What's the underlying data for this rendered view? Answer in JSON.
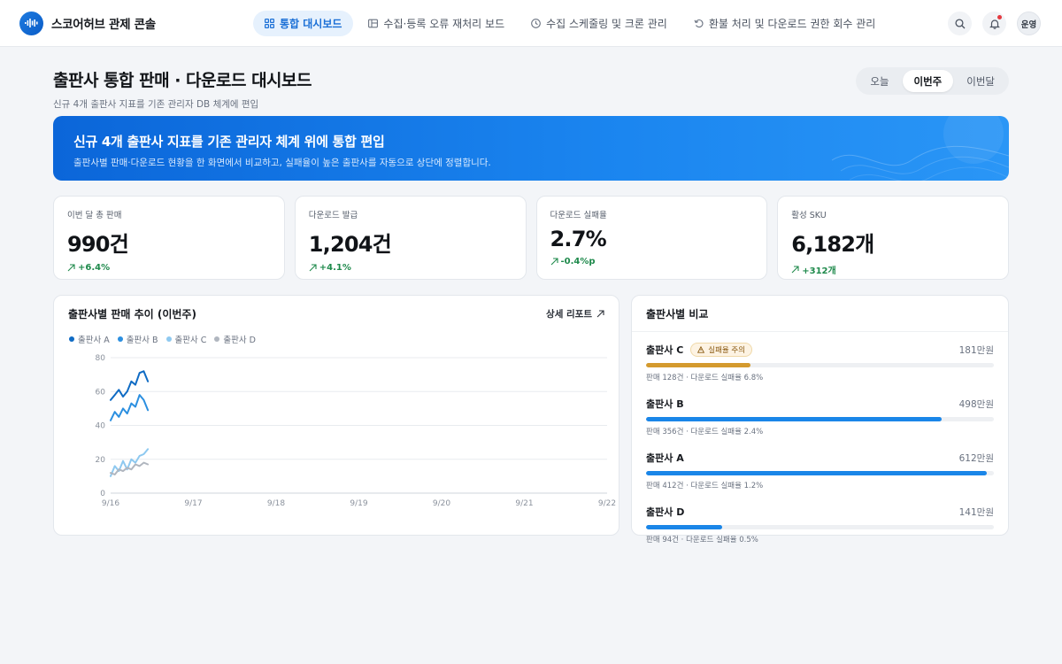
{
  "app": {
    "title": "스코어허브 관제 콘솔"
  },
  "nav": {
    "items": [
      {
        "label": "통합 대시보드",
        "icon": "grid-icon",
        "active": true
      },
      {
        "label": "수집·등록 오류 재처리 보드",
        "icon": "board-icon",
        "active": false
      },
      {
        "label": "수집 스케줄링 및 크론 관리",
        "icon": "clock-icon",
        "active": false
      },
      {
        "label": "환불 처리 및 다운로드 권한 회수 관리",
        "icon": "undo-icon",
        "active": false
      }
    ]
  },
  "user": {
    "avatar_label": "운영"
  },
  "header": {
    "title": "출판사 통합 판매 · 다운로드 대시보드",
    "subtitle": "신규 4개 출판사 지표를 기존 관리자 DB 체계에 편입"
  },
  "period": {
    "options": [
      "오늘",
      "이번주",
      "이번달"
    ],
    "selected": "이번주"
  },
  "banner": {
    "title": "신규 4개 출판사 지표를 기존 관리자 체계 위에 통합 편입",
    "subtitle": "출판사별 판매·다운로드 현황을 한 화면에서 비교하고, 실패율이 높은 출판사를 자동으로 상단에 정렬합니다."
  },
  "kpis": [
    {
      "label": "이번 달 총 판매",
      "value": "990건",
      "delta": "+6.4%"
    },
    {
      "label": "다운로드 발급",
      "value": "1,204건",
      "delta": "+4.1%"
    },
    {
      "label": "다운로드 실패율",
      "value": "2.7%",
      "delta": "-0.4%p"
    },
    {
      "label": "활성 SKU",
      "value": "6,182개",
      "delta": "+312개"
    }
  ],
  "trend_card": {
    "title": "출판사별 판매 추이 (이번주)",
    "link_label": "상세 리포트"
  },
  "chart_data": {
    "type": "line",
    "title": "",
    "xlabel": "",
    "ylabel": "",
    "x": [
      "9/16",
      "9/17",
      "9/18",
      "9/19",
      "9/20",
      "9/21",
      "9/22"
    ],
    "x_index_range": [
      0,
      6
    ],
    "ylim": [
      0,
      80
    ],
    "yticks": [
      0,
      20,
      40,
      60,
      80
    ],
    "grid": true,
    "legend_position": "top-left",
    "series": [
      {
        "name": "출판사 A",
        "color": "#0f6bc4",
        "points": [
          [
            0.0,
            55
          ],
          [
            0.05,
            58
          ],
          [
            0.1,
            61
          ],
          [
            0.15,
            57
          ],
          [
            0.2,
            60
          ],
          [
            0.25,
            66
          ],
          [
            0.3,
            64
          ],
          [
            0.35,
            71
          ],
          [
            0.4,
            72
          ],
          [
            0.45,
            66
          ]
        ]
      },
      {
        "name": "출판사 B",
        "color": "#2b8fe0",
        "points": [
          [
            0.0,
            43
          ],
          [
            0.05,
            48
          ],
          [
            0.1,
            45
          ],
          [
            0.15,
            50
          ],
          [
            0.2,
            47
          ],
          [
            0.25,
            53
          ],
          [
            0.3,
            51
          ],
          [
            0.35,
            58
          ],
          [
            0.4,
            55
          ],
          [
            0.45,
            49
          ]
        ]
      },
      {
        "name": "출판사 C",
        "color": "#8ec9f0",
        "points": [
          [
            0.0,
            10
          ],
          [
            0.05,
            16
          ],
          [
            0.1,
            13
          ],
          [
            0.15,
            19
          ],
          [
            0.2,
            14
          ],
          [
            0.25,
            20
          ],
          [
            0.3,
            18
          ],
          [
            0.35,
            22
          ],
          [
            0.4,
            23
          ],
          [
            0.45,
            26
          ]
        ]
      },
      {
        "name": "출판사 D",
        "color": "#b0b6bf",
        "points": [
          [
            0.0,
            12
          ],
          [
            0.05,
            11
          ],
          [
            0.1,
            14
          ],
          [
            0.15,
            13
          ],
          [
            0.2,
            15
          ],
          [
            0.25,
            14
          ],
          [
            0.3,
            17
          ],
          [
            0.35,
            16
          ],
          [
            0.4,
            18
          ],
          [
            0.45,
            17
          ]
        ]
      }
    ]
  },
  "compare_card": {
    "title": "출판사별 비교",
    "items": [
      {
        "name": "출판사 C",
        "badge": "실패율 주의",
        "amount": "181만원",
        "ratio": 0.3,
        "color": "#d49a2e",
        "meta": "판매 128건 · 다운로드 실패율 6.8%"
      },
      {
        "name": "출판사 B",
        "badge": "",
        "amount": "498만원",
        "ratio": 0.85,
        "color": "#1a86e8",
        "meta": "판매 356건 · 다운로드 실패율 2.4%"
      },
      {
        "name": "출판사 A",
        "badge": "",
        "amount": "612만원",
        "ratio": 0.98,
        "color": "#1a86e8",
        "meta": "판매 412건 · 다운로드 실패율 1.2%"
      },
      {
        "name": "출판사 D",
        "badge": "",
        "amount": "141만원",
        "ratio": 0.22,
        "color": "#1a86e8",
        "meta": "판매 94건 · 다운로드 실패율 0.5%"
      }
    ]
  }
}
